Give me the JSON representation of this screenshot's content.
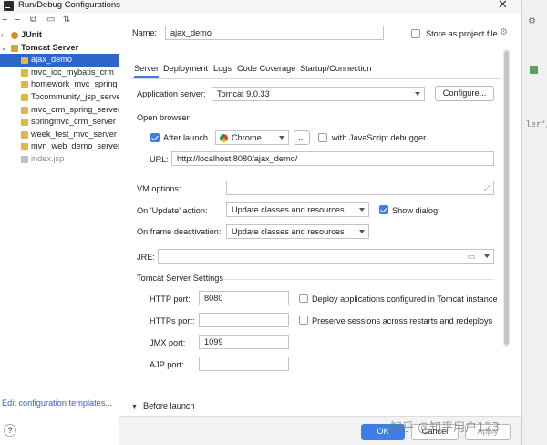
{
  "window": {
    "title": "Run/Debug Configurations",
    "close_glyph": "✕"
  },
  "toolbar": {
    "add": "+",
    "remove": "−",
    "copy": "⧉",
    "folder": "▭",
    "sort": "⇅"
  },
  "tree": {
    "items": [
      {
        "label": "JUnit",
        "arrow": "›",
        "icon": "junit-icon",
        "bold": true
      },
      {
        "label": "Tomcat Server",
        "arrow": "⌄",
        "icon": "tomcat-icon",
        "bold": true
      },
      {
        "label": "ajax_demo",
        "selected": true
      },
      {
        "label": "mvc_ioc_mybatis_crm"
      },
      {
        "label": "homework_mvc_spring_s"
      },
      {
        "label": "Tocommunity_jsp_server"
      },
      {
        "label": "mvc_crm_spring_server"
      },
      {
        "label": "springmvc_crm_server"
      },
      {
        "label": "week_test_mvc_server"
      },
      {
        "label": "mvn_web_demo_server"
      },
      {
        "label": "index.jsp",
        "dim": true
      }
    ],
    "edit_templates": "Edit configuration templates..."
  },
  "form": {
    "name_label": "Name:",
    "name_value": "ajax_demo",
    "store_label": "Store as project file"
  },
  "tabs": [
    "Server",
    "Deployment",
    "Logs",
    "Code Coverage",
    "Startup/Connection"
  ],
  "server": {
    "app_server_label": "Application server:",
    "app_server_value": "Tomcat 9.0.33",
    "configure_label": "Configure...",
    "open_browser_label": "Open browser",
    "after_launch_label": "After launch",
    "browser_value": "Chrome",
    "ellipsis": "...",
    "js_debugger_label": "with JavaScript debugger",
    "url_label": "URL:",
    "url_value": "http://localhost:8080/ajax_demo/",
    "vm_options_label": "VM options:",
    "on_update_label": "On 'Update' action:",
    "on_update_value": "Update classes and resources",
    "show_dialog_label": "Show dialog",
    "on_frame_label": "On frame deactivation:",
    "on_frame_value": "Update classes and resources",
    "jre_label": "JRE:",
    "tomcat_settings_label": "Tomcat Server Settings",
    "http_port_label": "HTTP port:",
    "http_port_value": "8080",
    "deploy_label": "Deploy applications configured in Tomcat instance",
    "https_port_label": "HTTPs port:",
    "https_port_value": "",
    "preserve_label": "Preserve sessions across restarts and redeploys",
    "jmx_port_label": "JMX port:",
    "jmx_port_value": "1099",
    "ajp_port_label": "AJP port:",
    "ajp_port_value": ""
  },
  "before_launch": "Before launch",
  "buttons": {
    "ok": "OK",
    "cancel": "Cancel",
    "apply": "Apply",
    "help": "?"
  },
  "editor_strip": {
    "text1": "ler\"/"
  },
  "watermark": "知乎 @知乎用户123",
  "colors": {
    "accent": "#3d7fe6",
    "selection": "#2f65ca"
  }
}
